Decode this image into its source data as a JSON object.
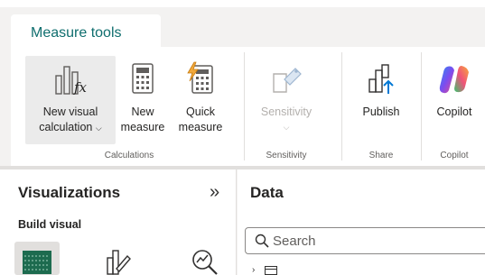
{
  "tabs": {
    "active_label": "Measure tools"
  },
  "ribbon": {
    "groups": {
      "calculations": {
        "label": "Calculations",
        "buttons": {
          "new_visual_calc": {
            "line1": "New visual",
            "line2": "calculation",
            "icon": "visual-calculation-icon"
          },
          "new_measure": {
            "line1": "New",
            "line2": "measure",
            "icon": "calculator-icon"
          },
          "quick_measure": {
            "line1": "Quick",
            "line2": "measure",
            "icon": "quick-measure-icon"
          }
        }
      },
      "sensitivity": {
        "label": "Sensitivity",
        "buttons": {
          "sensitivity": {
            "line1": "Sensitivity",
            "icon": "sensitivity-label-icon",
            "disabled": true
          }
        }
      },
      "share": {
        "label": "Share",
        "buttons": {
          "publish": {
            "line1": "Publish",
            "icon": "publish-icon"
          }
        }
      },
      "copilot": {
        "label": "Copilot",
        "buttons": {
          "copilot": {
            "line1": "Copilot",
            "icon": "copilot-icon"
          }
        }
      }
    }
  },
  "visualizations_pane": {
    "title": "Visualizations",
    "collapse_glyph": "»",
    "section_label": "Build visual"
  },
  "data_pane": {
    "title": "Data",
    "search": {
      "placeholder": "Search",
      "value": ""
    }
  },
  "colors": {
    "accent_teal": "#0f6e6e",
    "publish_blue": "#0078d4",
    "table_green": "#1d6b4f",
    "disabled": "#b3b0ad"
  }
}
